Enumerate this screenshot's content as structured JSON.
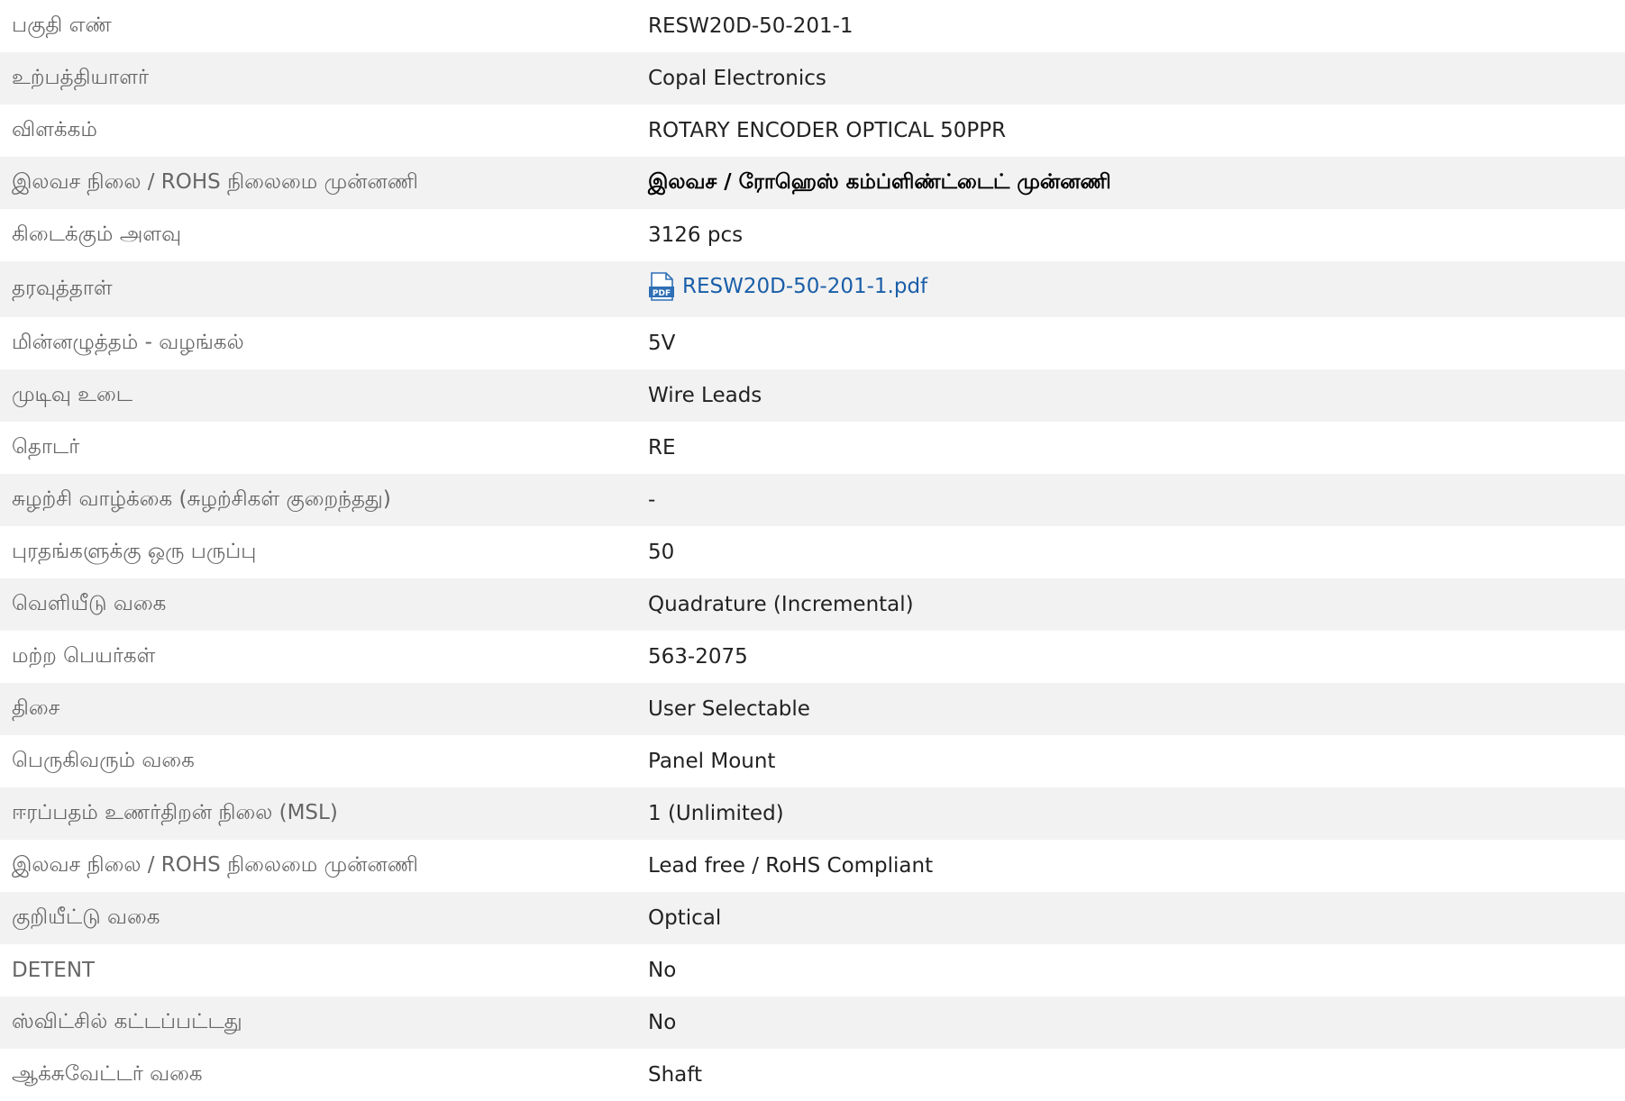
{
  "rows": [
    {
      "label": "பகுதி எண்",
      "value": "RESW20D-50-201-1"
    },
    {
      "label": "உற்பத்தியாளர்",
      "value": "Copal Electronics"
    },
    {
      "label": "விளக்கம்",
      "value": "ROTARY ENCODER OPTICAL 50PPR"
    },
    {
      "label": "இலவச நிலை / ROHS நிலைமை முன்னணி",
      "value": "இலவச / ரோஹெஸ் கம்ப்ளிண்ட்டைட் முன்னணி"
    },
    {
      "label": "கிடைக்கும் அளவு",
      "value": "3126 pcs"
    },
    {
      "label": "தரவுத்தாள்",
      "value": "RESW20D-50-201-1.pdf",
      "icon": "pdf-file-icon"
    },
    {
      "label": "மின்னழுத்தம் - வழங்கல்",
      "value": "5V"
    },
    {
      "label": "முடிவு உடை",
      "value": "Wire Leads"
    },
    {
      "label": "தொடர்",
      "value": "RE"
    },
    {
      "label": "சுழற்சி வாழ்க்கை (சுழற்சிகள் குறைந்தது)",
      "value": "-"
    },
    {
      "label": "புரதங்களுக்கு ஒரு பருப்பு",
      "value": "50"
    },
    {
      "label": "வெளியீடு வகை",
      "value": "Quadrature (Incremental)"
    },
    {
      "label": "மற்ற பெயர்கள்",
      "value": "563-2075"
    },
    {
      "label": "திசை",
      "value": "User Selectable"
    },
    {
      "label": "பெருகிவரும் வகை",
      "value": "Panel Mount"
    },
    {
      "label": "ஈரப்பதம் உணர்திறன் நிலை (MSL)",
      "value": "1 (Unlimited)"
    },
    {
      "label": "இலவச நிலை / ROHS நிலைமை முன்னணி",
      "value": "Lead free / RoHS Compliant"
    },
    {
      "label": "குறியீட்டு வகை",
      "value": "Optical"
    },
    {
      "label": "DETENT",
      "value": "No"
    },
    {
      "label": "ஸ்விட்சில் கட்டப்பட்டது",
      "value": "No"
    },
    {
      "label": "ஆக்சுவேட்டர் வகை",
      "value": "Shaft"
    }
  ],
  "colors": {
    "stripe": "#f2f2f2",
    "label_text": "#666666",
    "link": "#1a5ea8",
    "pdf_icon": "#2f6fb5"
  }
}
